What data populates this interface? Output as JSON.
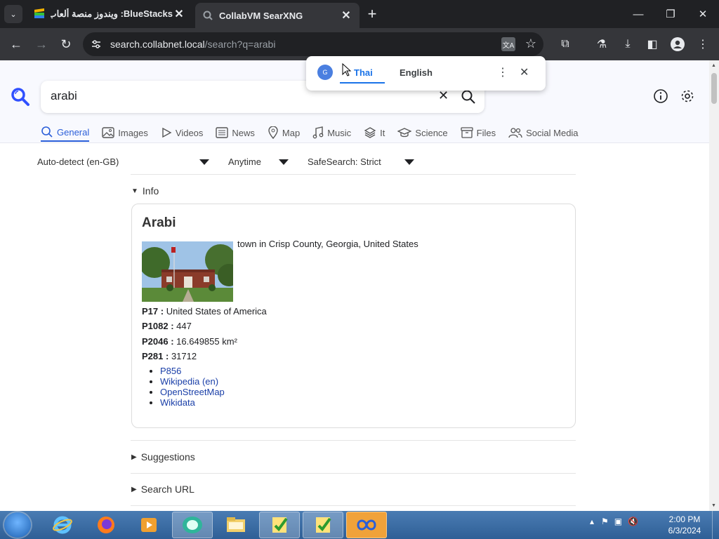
{
  "browser": {
    "tabs": [
      {
        "title": "BlueStacks: ويندوز منصة ألعاب سحابية",
        "favicon": "bluestacks-icon"
      },
      {
        "title": "CollabVM SearXNG",
        "favicon": "searxng-icon"
      }
    ],
    "address": {
      "host": "search.collabnet.local",
      "path": "/search?q=arabi"
    }
  },
  "translate_popup": {
    "lang_from": "Thai",
    "lang_to": "English"
  },
  "search": {
    "query": "arabi"
  },
  "categories": [
    {
      "label": "General",
      "icon": "search-icon",
      "active": true
    },
    {
      "label": "Images",
      "icon": "image-icon"
    },
    {
      "label": "Videos",
      "icon": "play-icon"
    },
    {
      "label": "News",
      "icon": "newspaper-icon"
    },
    {
      "label": "Map",
      "icon": "map-pin-icon"
    },
    {
      "label": "Music",
      "icon": "music-icon"
    },
    {
      "label": "It",
      "icon": "layers-icon"
    },
    {
      "label": "Science",
      "icon": "graduation-cap-icon"
    },
    {
      "label": "Files",
      "icon": "archive-icon"
    },
    {
      "label": "Social Media",
      "icon": "people-icon"
    }
  ],
  "filters": {
    "language": "Auto-detect (en-GB)",
    "time": "Anytime",
    "safesearch": "SafeSearch: Strict"
  },
  "sections": {
    "info": "Info",
    "suggestions": "Suggestions",
    "search_url": "Search URL"
  },
  "infobox": {
    "title": "Arabi",
    "description": "town in Crisp County, Georgia, United States",
    "attributes": [
      {
        "key": "P17 :",
        "value": "United States of America"
      },
      {
        "key": "P1082 :",
        "value": "447"
      },
      {
        "key": "P2046 :",
        "value": "16.649855 km²"
      },
      {
        "key": "P281 :",
        "value": "31712"
      }
    ],
    "links": [
      "P856",
      "Wikipedia (en)",
      "OpenStreetMap",
      "Wikidata"
    ]
  },
  "taskbar": {
    "time": "2:00 PM",
    "date": "6/3/2024"
  }
}
